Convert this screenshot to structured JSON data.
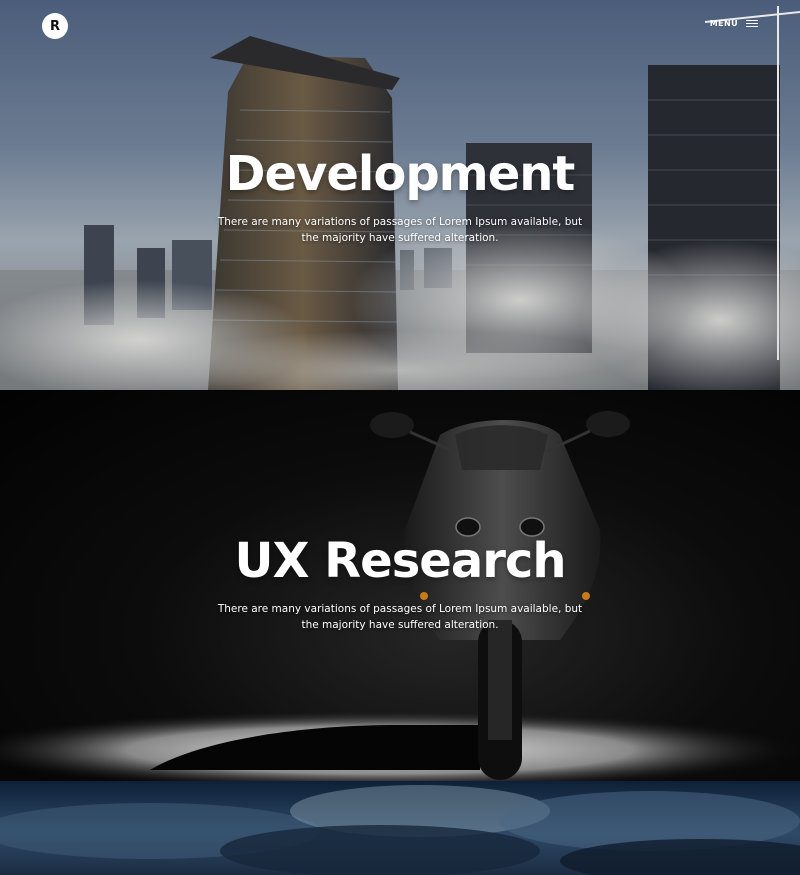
{
  "header": {
    "logo_letter": "R",
    "menu_label": "MENU",
    "menu_icon": "hamburger-icon"
  },
  "sections": [
    {
      "title": "Development",
      "description": "There are many variations of passages of Lorem Ipsum available, but the majority have suffered alteration.",
      "background": "foggy-skyscrapers-photo"
    },
    {
      "title": "UX Research",
      "description": "There are many variations of passages of Lorem Ipsum available, but the majority have suffered alteration.",
      "background": "motorcycle-spotlight-photo"
    },
    {
      "title": "",
      "description": "",
      "background": "cloudy-sky-photo"
    }
  ],
  "colors": {
    "text": "#ffffff",
    "logo_bg": "#ffffff"
  }
}
